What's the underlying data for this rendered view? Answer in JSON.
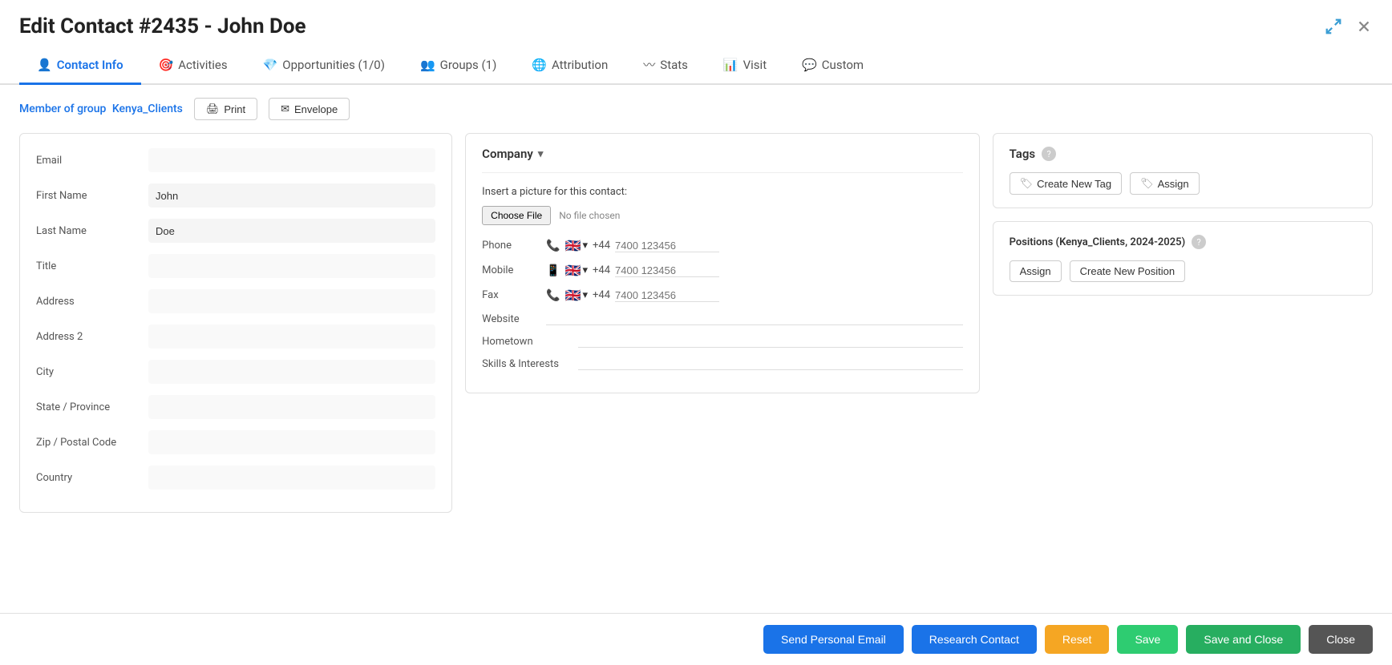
{
  "modal": {
    "title": "Edit Contact #2435 - John Doe"
  },
  "tabs": [
    {
      "id": "contact-info",
      "label": "Contact Info",
      "icon": "👤",
      "active": true
    },
    {
      "id": "activities",
      "label": "Activities",
      "icon": "🎯",
      "active": false
    },
    {
      "id": "opportunities",
      "label": "Opportunities (1/0)",
      "icon": "💎",
      "active": false
    },
    {
      "id": "groups",
      "label": "Groups (1)",
      "icon": "👥",
      "active": false
    },
    {
      "id": "attribution",
      "label": "Attribution",
      "icon": "🌐",
      "active": false
    },
    {
      "id": "stats",
      "label": "Stats",
      "icon": "〰",
      "active": false
    },
    {
      "id": "visit",
      "label": "Visit",
      "icon": "📊",
      "active": false
    },
    {
      "id": "custom",
      "label": "Custom",
      "icon": "💬",
      "active": false
    }
  ],
  "group_bar": {
    "prefix": "Member of group",
    "group_name": "Kenya_Clients",
    "print_label": "Print",
    "envelope_label": "Envelope"
  },
  "left_col": {
    "fields": [
      {
        "label": "Email",
        "value": "",
        "placeholder": ""
      },
      {
        "label": "First Name",
        "value": "John",
        "placeholder": ""
      },
      {
        "label": "Last Name",
        "value": "Doe",
        "placeholder": ""
      },
      {
        "label": "Title",
        "value": "",
        "placeholder": ""
      },
      {
        "label": "Address",
        "value": "",
        "placeholder": ""
      },
      {
        "label": "Address 2",
        "value": "",
        "placeholder": ""
      },
      {
        "label": "City",
        "value": "",
        "placeholder": ""
      },
      {
        "label": "State / Province",
        "value": "",
        "placeholder": ""
      },
      {
        "label": "Zip / Postal Code",
        "value": "",
        "placeholder": ""
      },
      {
        "label": "Country",
        "value": "",
        "placeholder": ""
      }
    ]
  },
  "middle_col": {
    "company_label": "Company",
    "picture_label": "Insert a picture for this contact:",
    "choose_file_label": "Choose File",
    "no_file_label": "No file chosen",
    "phone": {
      "label": "Phone",
      "flag": "🇬🇧",
      "prefix": "+44",
      "placeholder": "7400 123456"
    },
    "mobile": {
      "label": "Mobile",
      "flag": "🇬🇧",
      "prefix": "+44",
      "placeholder": "7400 123456"
    },
    "fax": {
      "label": "Fax",
      "flag": "🇬🇧",
      "prefix": "+44",
      "placeholder": "7400 123456"
    },
    "website_label": "Website",
    "hometown_label": "Hometown",
    "skills_label": "Skills & Interests"
  },
  "right_col": {
    "tags_panel": {
      "title": "Tags",
      "create_new_label": "Create New Tag",
      "assign_label": "Assign"
    },
    "positions_panel": {
      "title": "Positions (Kenya_Clients, 2024-2025)",
      "assign_label": "Assign",
      "create_new_label": "Create New Position"
    }
  },
  "bottom_bar": {
    "send_email_label": "Send Personal Email",
    "research_label": "Research Contact",
    "reset_label": "Reset",
    "save_label": "Save",
    "save_close_label": "Save and Close",
    "close_label": "Close"
  }
}
